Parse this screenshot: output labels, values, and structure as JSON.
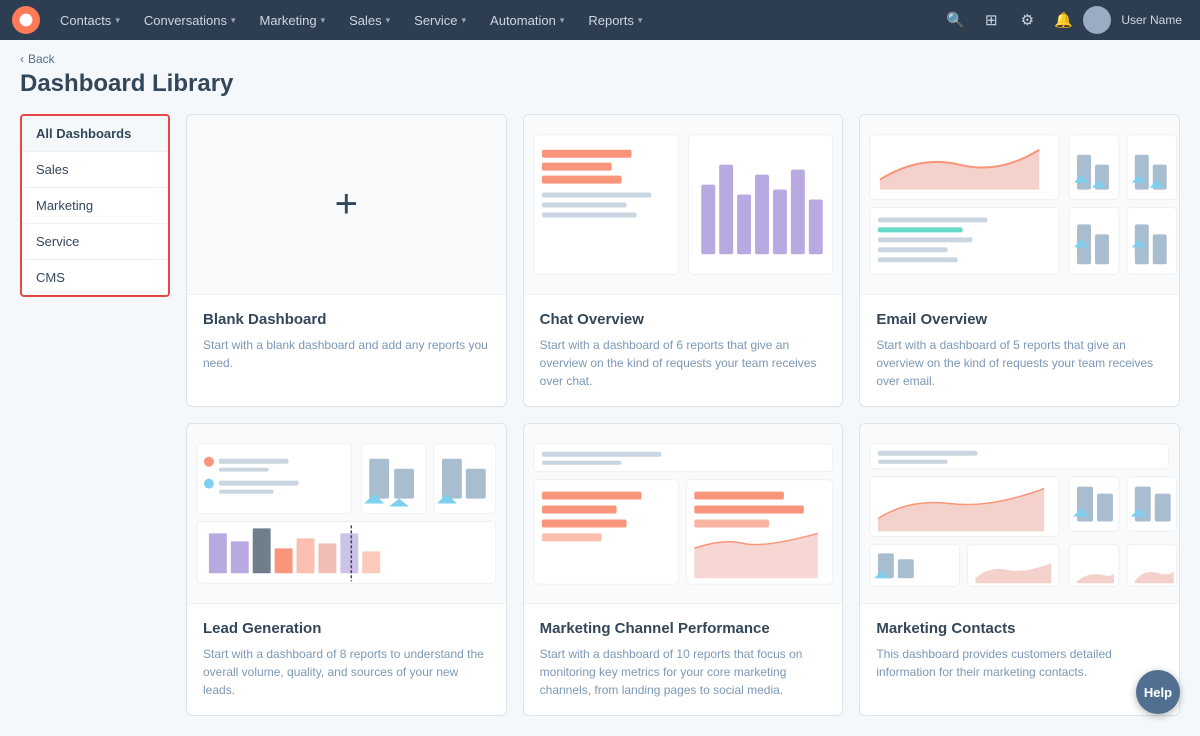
{
  "nav": {
    "items": [
      {
        "label": "Contacts",
        "id": "contacts"
      },
      {
        "label": "Conversations",
        "id": "conversations"
      },
      {
        "label": "Marketing",
        "id": "marketing"
      },
      {
        "label": "Sales",
        "id": "sales"
      },
      {
        "label": "Service",
        "id": "service"
      },
      {
        "label": "Automation",
        "id": "automation"
      },
      {
        "label": "Reports",
        "id": "reports"
      }
    ],
    "user_name": "User Name"
  },
  "back_label": "Back",
  "page_title": "Dashboard Library",
  "sidebar": {
    "items": [
      {
        "label": "All Dashboards",
        "active": true
      },
      {
        "label": "Sales",
        "active": false
      },
      {
        "label": "Marketing",
        "active": false
      },
      {
        "label": "Service",
        "active": false
      },
      {
        "label": "CMS",
        "active": false
      }
    ]
  },
  "cards": [
    {
      "id": "blank",
      "title": "Blank Dashboard",
      "desc": "Start with a blank dashboard and add any reports you need.",
      "type": "blank"
    },
    {
      "id": "chat-overview",
      "title": "Chat Overview",
      "desc": "Start with a dashboard of 6 reports that give an overview on the kind of requests your team receives over chat.",
      "type": "chat"
    },
    {
      "id": "email-overview",
      "title": "Email Overview",
      "desc": "Start with a dashboard of 5 reports that give an overview on the kind of requests your team receives over email.",
      "type": "email"
    },
    {
      "id": "lead-generation",
      "title": "Lead Generation",
      "desc": "Start with a dashboard of 8 reports to understand the overall volume, quality, and sources of your new leads.",
      "type": "lead"
    },
    {
      "id": "marketing-channel",
      "title": "Marketing Channel Performance",
      "desc": "Start with a dashboard of 10 reports that focus on monitoring key metrics for your core marketing channels, from landing pages to social media.",
      "type": "marketing"
    },
    {
      "id": "marketing-contacts",
      "title": "Marketing Contacts",
      "desc": "This dashboard provides customers detailed information for their marketing contacts.",
      "type": "contacts"
    }
  ],
  "help_label": "Help",
  "colors": {
    "orange": "#f8957a",
    "purple": "#b8a9e0",
    "blue": "#7ecff0",
    "teal": "#00bda5",
    "pink": "#f0bdb5",
    "gray_line": "#c9d6e2",
    "gray_bar": "#a8bdd0"
  }
}
